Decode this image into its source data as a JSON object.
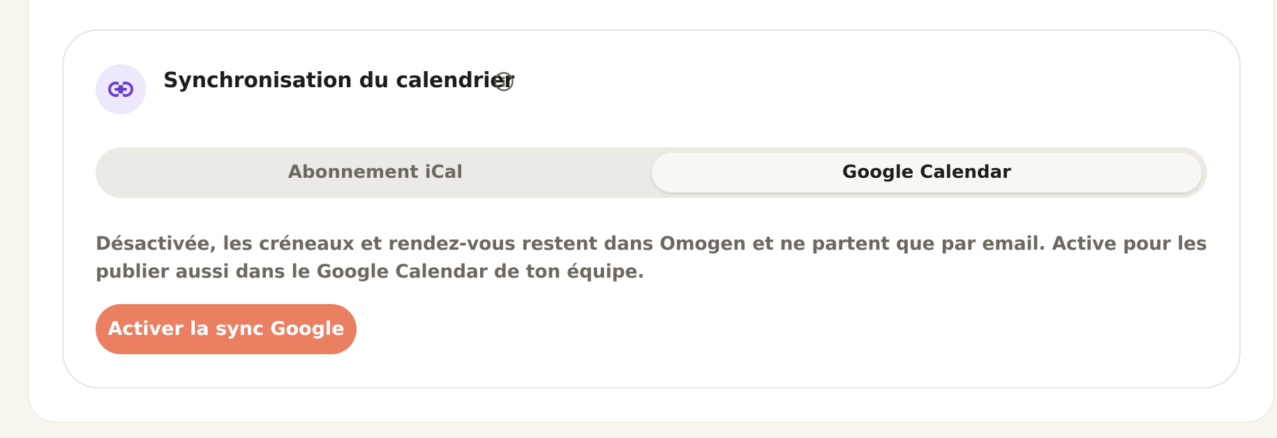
{
  "sync_card": {
    "title": "Synchronisation du calendrier",
    "icon": "link-icon",
    "info_icon": "info-icon",
    "tabs": [
      {
        "label": "Abonnement iCal",
        "selected": false
      },
      {
        "label": "Google Calendar",
        "selected": true
      }
    ],
    "description": "Désactivée, les créneaux et rendez-vous restent dans Omogen et ne partent que par email. Active pour les publier aussi dans le Google Calendar de ton équipe.",
    "activate_button": "Activer la sync Google"
  },
  "colors": {
    "accent_button": "#eb7f61",
    "icon_purple": "#6c3fd1",
    "badge_bg": "#ede8fb",
    "page_bg": "#f8f4ee"
  }
}
